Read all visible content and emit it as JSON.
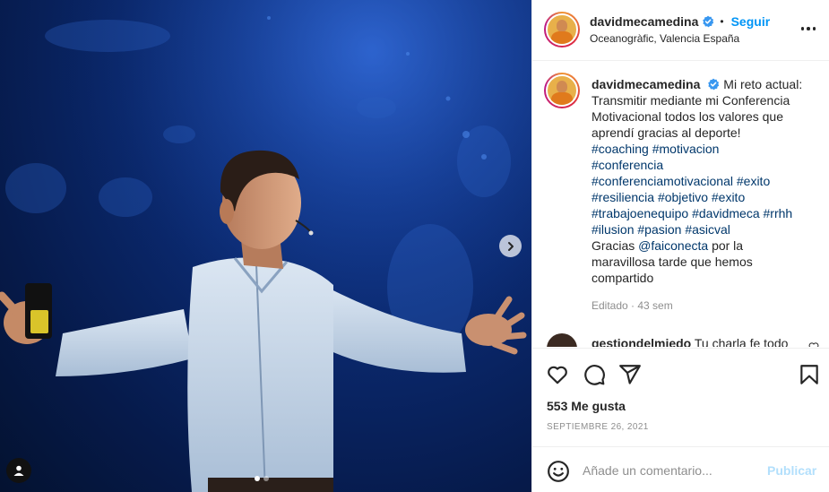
{
  "post": {
    "author": "davidmecamedina",
    "follow_label": "Seguir",
    "separator": "•",
    "location": "Oceanogràfic, Valencia España",
    "caption_intro": "Mi reto actual:",
    "caption_lines": [
      "Transmitir mediante mi Conferencia",
      "Motivacional todos los valores que",
      "aprendí gracias al deporte!"
    ],
    "hashtags_1": [
      "#coaching",
      "#motivacion"
    ],
    "hashtags_2": [
      "#conferencia"
    ],
    "hashtags_3": [
      "#conferenciamotivacional",
      "#exito"
    ],
    "hashtags_4": [
      "#resiliencia",
      "#objetivo",
      "#exito"
    ],
    "hashtags_5": [
      "#trabajoenequipo",
      "#davidmeca",
      "#rrhh"
    ],
    "hashtags_6": [
      "#ilusion",
      "#pasion",
      "#asicval"
    ],
    "thanks_prefix": "Gracias",
    "mention": "@faiconecta",
    "thanks_suffix": "por la",
    "closing_lines": [
      "maravillosa tarde que hemos",
      "compartido"
    ],
    "meta": "Editado · 43 sem",
    "likes": "553 Me gusta",
    "date": "SEPTIEMBRE 26, 2021"
  },
  "comment_preview": {
    "user": "gestiondelmiedo",
    "text": "Tu charla fe todo"
  },
  "add_comment": {
    "placeholder": "Añade un comentario...",
    "post_label": "Publicar"
  },
  "carousel": {
    "slides": 2,
    "active": 1
  },
  "icons": {
    "verified": "verified-badge-icon",
    "more": "more-options-icon",
    "like": "heart-icon",
    "comment": "comment-icon",
    "share": "share-icon",
    "save": "bookmark-icon",
    "emoji": "emoji-icon",
    "next": "chevron-right-icon",
    "tagged": "person-tag-icon"
  },
  "colors": {
    "accent": "#0095f6",
    "hashtag": "#00376b",
    "muted": "#8e8e8e",
    "post_disabled": "#b2dffc",
    "verified": "#3897f0"
  }
}
